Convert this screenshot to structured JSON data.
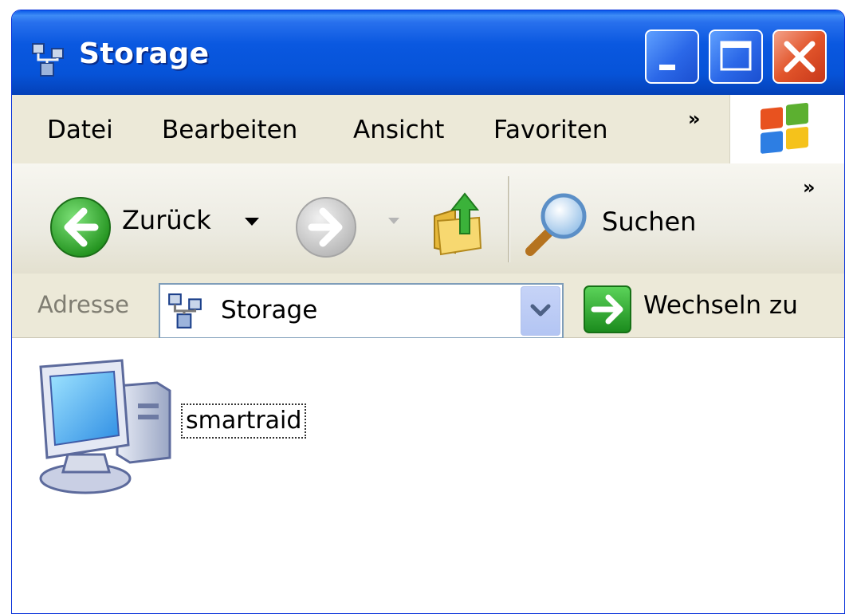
{
  "window": {
    "title": "Storage",
    "title_icon": "network-storage-icon"
  },
  "window_controls": {
    "minimize": "minimize-icon",
    "maximize": "maximize-icon",
    "close": "close-icon"
  },
  "menubar": {
    "items": [
      {
        "label": "Datei"
      },
      {
        "label": "Bearbeiten"
      },
      {
        "label": "Ansicht"
      },
      {
        "label": "Favoriten"
      }
    ],
    "overflow": "»"
  },
  "toolbar": {
    "back_label": "Zurück",
    "search_label": "Suchen",
    "overflow": "»"
  },
  "address": {
    "label": "Adresse",
    "value": "Storage",
    "go_label": "Wechseln zu"
  },
  "content": {
    "items": [
      {
        "label": "smartraid",
        "icon": "computer-icon"
      }
    ]
  },
  "colors": {
    "titlebar": "#0653d8",
    "chrome": "#ece9d8",
    "close_button": "#e2552b",
    "back_arrow": "#2fa32c",
    "go_arrow": "#26a02a"
  }
}
